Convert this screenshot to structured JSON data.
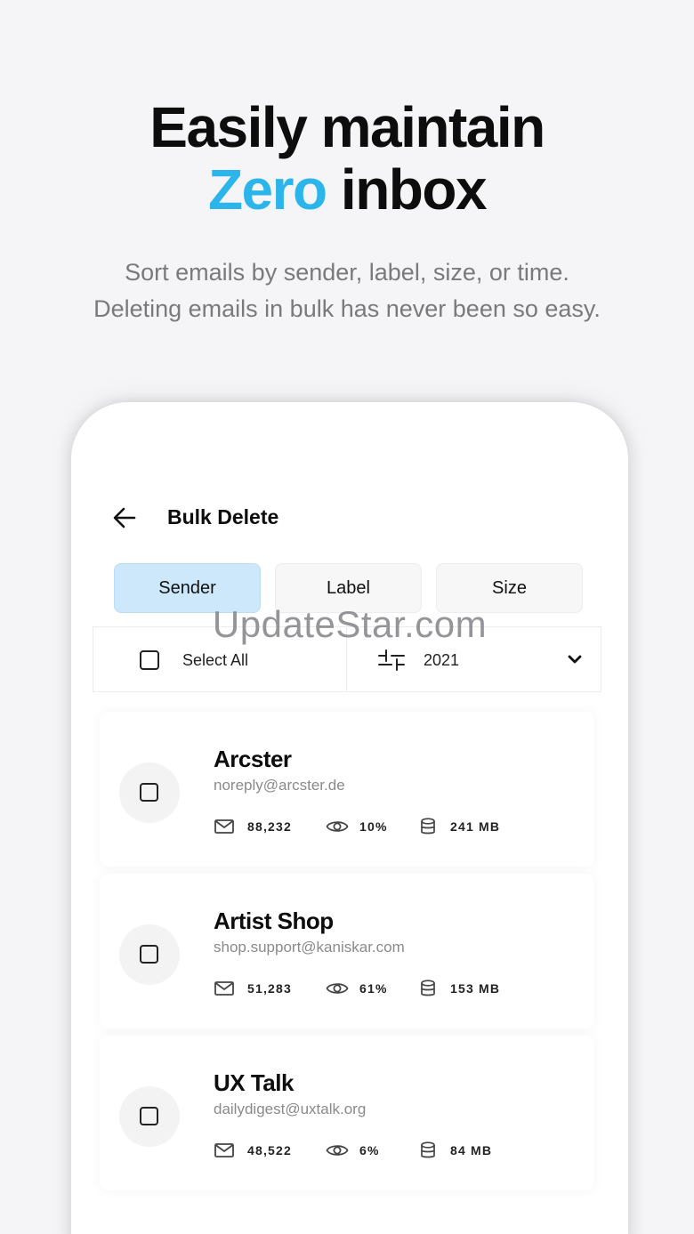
{
  "headline": {
    "line1": "Easily maintain",
    "accent": "Zero",
    "line2_rest": " inbox"
  },
  "subtitle": {
    "line1": "Sort emails by sender, label, size, or time.",
    "line2": "Deleting emails in bulk has never been so easy."
  },
  "colors": {
    "accent": "#2bb5ea",
    "active_tab": "#cde7fb",
    "background": "#f5f5f7"
  },
  "watermark": "UpdateStar.com",
  "appbar": {
    "back_icon": "arrow-left-icon",
    "title": "Bulk Delete"
  },
  "tabs": [
    {
      "label": "Sender",
      "active": true
    },
    {
      "label": "Label",
      "active": false
    },
    {
      "label": "Size",
      "active": false
    }
  ],
  "filter": {
    "select_all_label": "Select All",
    "year": "2021",
    "filter_icon": "sliders-icon",
    "dropdown_icon": "chevron-down-icon"
  },
  "senders": [
    {
      "name": "Arcster",
      "email": "noreply@arcster.de",
      "count": "88,232",
      "open_rate": "10%",
      "size": "241 MB"
    },
    {
      "name": "Artist Shop",
      "email": "shop.support@kaniskar.com",
      "count": "51,283",
      "open_rate": "61%",
      "size": "153 MB"
    },
    {
      "name": "UX Talk",
      "email": "dailydigest@uxtalk.org",
      "count": "48,522",
      "open_rate": "6%",
      "size": "84 MB"
    }
  ]
}
